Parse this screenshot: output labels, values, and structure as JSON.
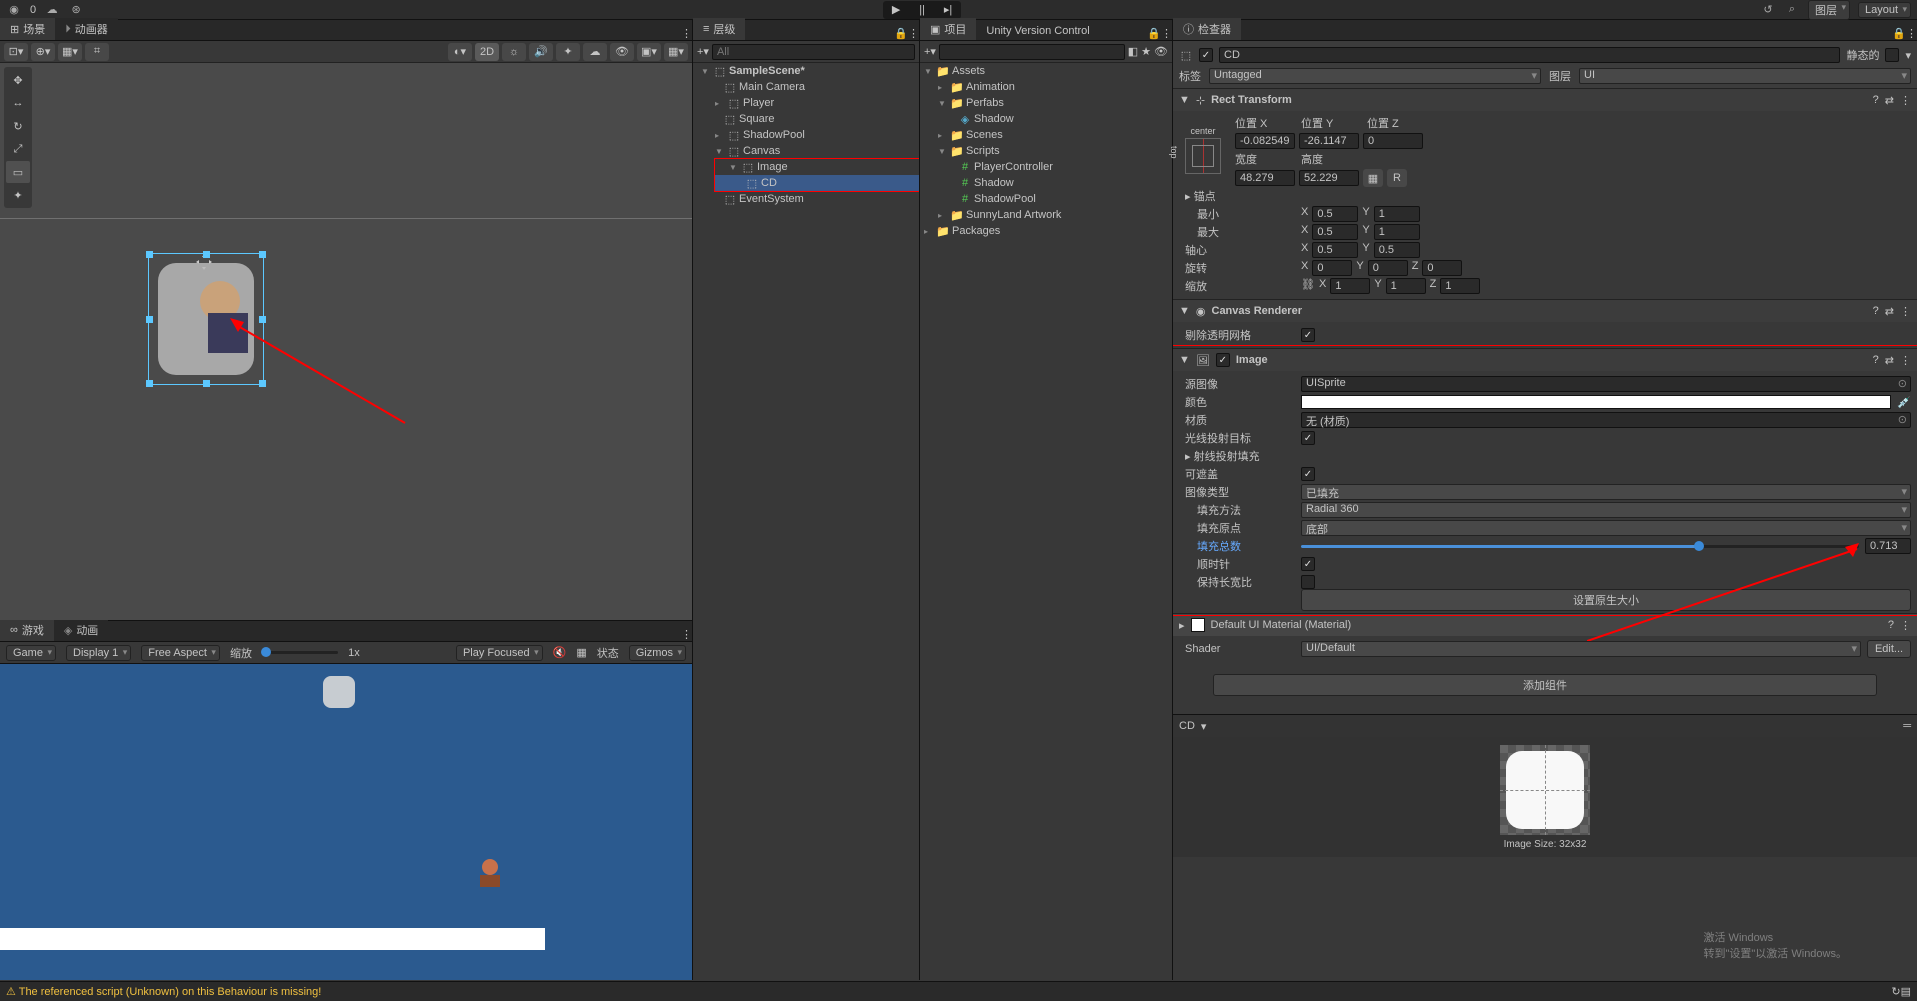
{
  "topbar": {
    "account": "0",
    "center": {
      "play": "▶",
      "pause": "||",
      "step": "▸|"
    },
    "search": "⌕",
    "layers": "图层",
    "layout": "Layout"
  },
  "sceneTab": "场景",
  "animatorTab": "动画器",
  "sceneToolbar": {
    "mode2d": "2D"
  },
  "hierarchy": {
    "tab": "层级",
    "search_placeholder": "All",
    "root": "SampleScene*",
    "items": [
      "Main Camera",
      "Player",
      "Square",
      "ShadowPool",
      "Canvas",
      "Image",
      "CD",
      "EventSystem"
    ]
  },
  "project": {
    "tab": "项目",
    "uvc": "Unity Version Control",
    "assets": "Assets",
    "animation": "Animation",
    "perfabs": "Perfabs",
    "shadow": "Shadow",
    "scenes": "Scenes",
    "scripts": "Scripts",
    "playerctrl": "PlayerController",
    "shadowScript": "Shadow",
    "shadowpool": "ShadowPool",
    "sunny": "SunnyLand Artwork",
    "packages": "Packages"
  },
  "game": {
    "tab": "游戏",
    "animTab": "动画",
    "display": "Display 1",
    "aspect": "Free Aspect",
    "scale": "缩放",
    "scale_val": "1x",
    "focus": "Play Focused",
    "status": "状态",
    "gizmos": "Gizmos"
  },
  "inspector": {
    "tab": "检查器",
    "name": "CD",
    "static": "静态的",
    "tag_label": "标签",
    "tag_value": "Untagged",
    "layer_label": "图层",
    "layer_value": "UI",
    "rect": {
      "title": "Rect Transform",
      "anchor": "center",
      "pivot_side": "top",
      "posx_l": "位置 X",
      "posy_l": "位置 Y",
      "posz_l": "位置 Z",
      "posx": "-0.082549",
      "posy": "-26.1147",
      "posz": "0",
      "w_l": "宽度",
      "h_l": "高度",
      "w": "48.279",
      "h": "52.229",
      "anchors": "锚点",
      "min": "最小",
      "max": "最大",
      "pivot": "轴心",
      "rot": "旋转",
      "scale": "缩放",
      "minx": "0.5",
      "miny": "1",
      "maxx": "0.5",
      "maxy": "1",
      "pvx": "0.5",
      "pvy": "0.5",
      "rx": "0",
      "ry": "0",
      "rz": "0",
      "sx": "1",
      "sy": "1",
      "sz": "1"
    },
    "canvasRenderer": {
      "title": "Canvas Renderer",
      "cull": "剔除透明网格"
    },
    "image": {
      "title": "Image",
      "source": "源图像",
      "source_val": "UISprite",
      "color": "颜色",
      "material": "材质",
      "material_val": "无 (材质)",
      "raycast": "光线投射目标",
      "raycastPad": "射线投射填充",
      "maskable": "可遮盖",
      "type": "图像类型",
      "type_val": "已填充",
      "fillMethod": "填充方法",
      "fillMethod_val": "Radial 360",
      "fillOrigin": "填充原点",
      "fillOrigin_val": "底部",
      "fillAmount": "填充总数",
      "fillAmount_val": "0.713",
      "clockwise": "顺时针",
      "preserve": "保持长宽比",
      "nativeSize": "设置原生大小"
    },
    "material": {
      "title": "Default UI Material (Material)",
      "shader": "Shader",
      "shader_val": "UI/Default",
      "edit": "Edit..."
    },
    "addComponent": "添加组件",
    "preview": "CD",
    "imgsize": "Image Size: 32x32"
  },
  "status": {
    "warning": "The referenced script (Unknown) on this Behaviour is missing!"
  },
  "watermark": {
    "l1": "激活 Windows",
    "l2": "转到\"设置\"以激活 Windows。"
  }
}
